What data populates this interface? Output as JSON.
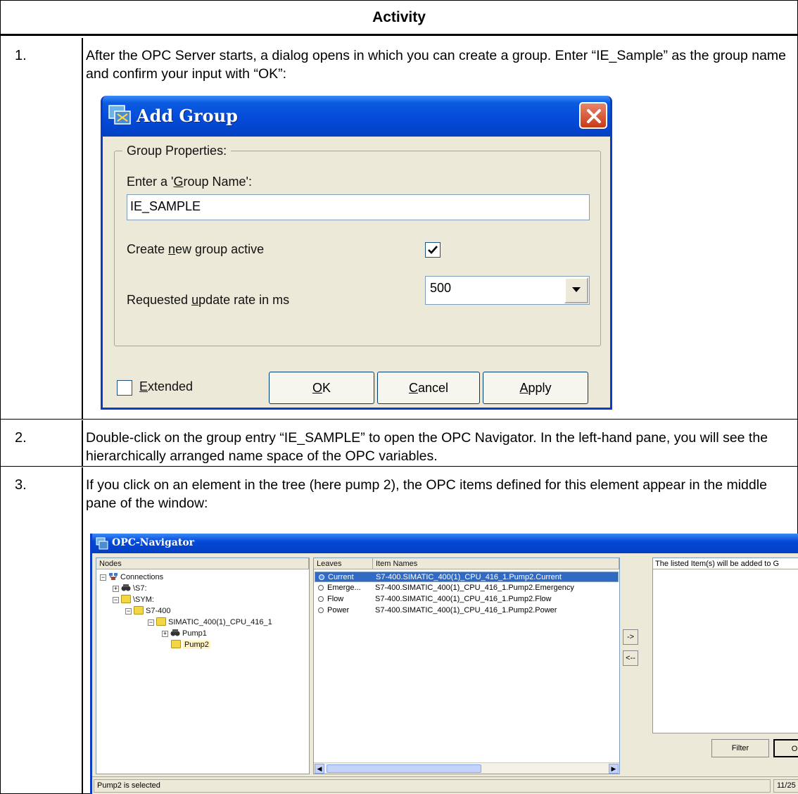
{
  "table": {
    "header": "Activity",
    "rows": [
      {
        "num": "1.",
        "text": "After the OPC Server starts, a dialog opens in which you can create a group. Enter “IE_Sample” as the group name and confirm your input with “OK”:"
      },
      {
        "num": "2.",
        "text": "Double-click on the group entry “IE_SAMPLE” to open the OPC Navigator. In the left-hand pane, you will see the hierarchically arranged name space of the OPC variables."
      },
      {
        "num": "3.",
        "text": "If you click on an element in the tree (here pump 2), the OPC items defined for this element appear in the middle pane of the window:"
      }
    ]
  },
  "add_group_dialog": {
    "title": "Add Group",
    "group_legend": "Group Properties:",
    "name_label": {
      "pre": "Enter a '",
      "accel": "G",
      "post": "roup Name':"
    },
    "name_value": "IE_SAMPLE",
    "active_label": {
      "pre": "Create ",
      "accel": "n",
      "post": "ew group active"
    },
    "active_checked": true,
    "rate_label": {
      "pre": "Requested ",
      "accel": "u",
      "post": "pdate rate in ms"
    },
    "rate_value": "500",
    "extended": {
      "accel": "E",
      "post": "xtended",
      "checked": false
    },
    "buttons": {
      "ok": {
        "accel": "O",
        "post": "K"
      },
      "cancel": {
        "accel": "C",
        "post": "ancel"
      },
      "apply": {
        "accel": "A",
        "post": "pply"
      }
    }
  },
  "opc_navigator": {
    "title": "OPC-Navigator",
    "nodes_header": "Nodes",
    "tree": [
      {
        "label": "Connections",
        "icon": "network-icon",
        "expander": "−",
        "level": 0
      },
      {
        "label": "\\S7:",
        "icon": "binoculars-icon",
        "expander": "+",
        "level": 1
      },
      {
        "label": "\\SYM:",
        "icon": "folder-icon",
        "expander": "−",
        "level": 1
      },
      {
        "label": "S7-400",
        "icon": "folder-icon",
        "expander": "−",
        "level": 2
      },
      {
        "label": "SIMATIC_400(1)_CPU_416_1",
        "icon": "folder-icon",
        "expander": "−",
        "level": 3
      },
      {
        "label": "Pump1",
        "icon": "binoculars-icon",
        "expander": "+",
        "level": 4
      },
      {
        "label": "Pump2",
        "icon": "folder-icon",
        "expander": "",
        "level": 4,
        "selected": true
      }
    ],
    "leaves_header": "Leaves",
    "item_names_header": "Item Names",
    "leaves": [
      {
        "leaf": "Current",
        "item": "S7-400.SIMATIC_400(1)_CPU_416_1.Pump2.Current",
        "selected": true
      },
      {
        "leaf": "Emerge...",
        "item": "S7-400.SIMATIC_400(1)_CPU_416_1.Pump2.Emergency"
      },
      {
        "leaf": "Flow",
        "item": "S7-400.SIMATIC_400(1)_CPU_416_1.Pump2.Flow"
      },
      {
        "leaf": "Power",
        "item": "S7-400.SIMATIC_400(1)_CPU_416_1.Pump2.Power"
      }
    ],
    "add_button": "->",
    "remove_button": "<--",
    "right_header": "The listed Item(s) will be added to G",
    "filter_button": "Filter",
    "ok_button": "O",
    "status_text": "Pump2 is selected",
    "status_count": "11/25"
  }
}
